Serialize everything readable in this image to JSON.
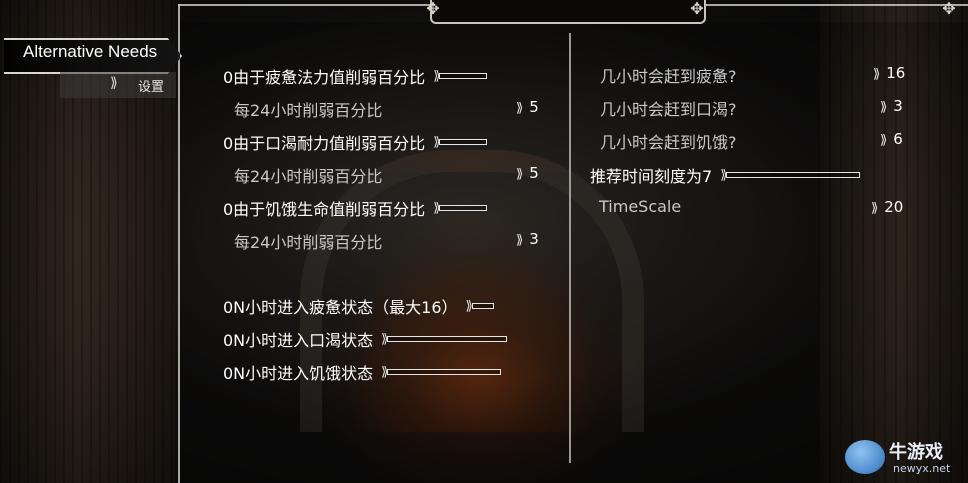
{
  "mod_tab": {
    "label": "Alternative Needs"
  },
  "sub_tab": {
    "label": "设置",
    "icon": "gear-icon"
  },
  "left_column": [
    {
      "label": "0由于疲惫法力值削弱百分比",
      "kind": "slider",
      "id": "fatigue-magicka"
    },
    {
      "label": "每24小时削弱百分比",
      "kind": "value",
      "value": "5",
      "id": "fatigue-rate"
    },
    {
      "label": "0由于口渴耐力值削弱百分比",
      "kind": "slider",
      "id": "thirst-stamina"
    },
    {
      "label": "每24小时削弱百分比",
      "kind": "value",
      "value": "5",
      "id": "thirst-rate"
    },
    {
      "label": "0由于饥饿生命值削弱百分比",
      "kind": "slider",
      "id": "hunger-health"
    },
    {
      "label": "每24小时削弱百分比",
      "kind": "value",
      "value": "3",
      "id": "hunger-rate"
    },
    {
      "label": "0N小时进入疲惫状态（最大16）",
      "kind": "slider",
      "id": "fatigue-hours"
    },
    {
      "label": "0N小时进入口渴状态",
      "kind": "slider",
      "id": "thirst-hours"
    },
    {
      "label": "0N小时进入饥饿状态",
      "kind": "slider",
      "id": "hunger-hours"
    }
  ],
  "right_column": [
    {
      "label": "几小时会赶到疲惫?",
      "kind": "value",
      "value": "16",
      "id": "hours-to-fatigue"
    },
    {
      "label": "几小时会赶到口渴?",
      "kind": "value",
      "value": "3",
      "id": "hours-to-thirst"
    },
    {
      "label": "几小时会赶到饥饿?",
      "kind": "value",
      "value": "6",
      "id": "hours-to-hunger"
    },
    {
      "label": "推荐时间刻度为7",
      "kind": "slider",
      "id": "recommended-timescale"
    },
    {
      "label": "TimeScale",
      "kind": "value",
      "value": "20",
      "id": "timescale"
    }
  ],
  "watermark": {
    "name": "牛游戏",
    "url": "newyx.net"
  },
  "colors": {
    "text": "#ffffff",
    "dim_text": "#c9c9c9",
    "frame": "#c9c6bf",
    "slider": "#e6e6e6"
  }
}
